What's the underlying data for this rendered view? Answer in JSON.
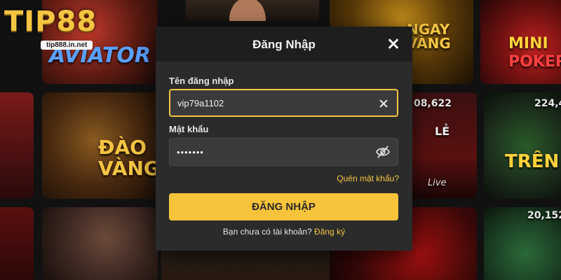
{
  "brand": {
    "logo_text": "TIP88",
    "url": "tip888.in.net"
  },
  "background": {
    "aviator": "AVIATOR",
    "ngay_vang": "NGAY\nVÀNG",
    "mini": "MINI",
    "poker": "POKER",
    "dao_vang": "ĐÀO\nVÀNG",
    "le": "LẺ",
    "live": "Live",
    "number_1": "08,622",
    "number_2": "224,4",
    "number_3": "20,152",
    "tre": "TRÊN"
  },
  "modal": {
    "title": "Đăng Nhập",
    "username_label": "Tên đăng nhập",
    "username_value": "vip79a1102",
    "password_label": "Mật khẩu",
    "password_value": "•••••••",
    "forgot_label": "Quên mật khẩu?",
    "login_button": "ĐĂNG NHẬP",
    "no_account_text": "Bạn chưa có tài khoản?",
    "signup_link": "Đăng ký"
  },
  "colors": {
    "accent": "#f5c542",
    "modal_bg": "#2b2b2b",
    "header_bg": "#1e1e1e",
    "button_bg": "#f6c33a"
  }
}
